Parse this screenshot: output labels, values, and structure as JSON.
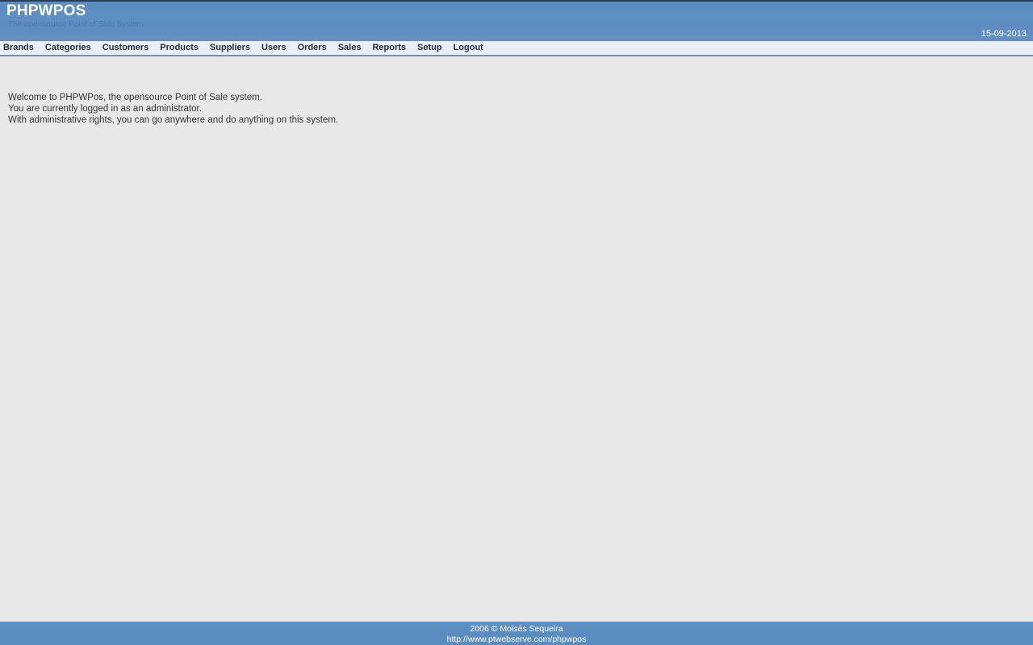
{
  "header": {
    "title": "PHPWPOS",
    "subtitle": "The opensource Point of Sale System",
    "date": "15-09-2013",
    "background_color": "#5b8cc0",
    "title_color": "#ffffff",
    "subtitle_color": "#4b7aad"
  },
  "nav": {
    "background_color": "#e9eff9",
    "text_color": "#1f2c3b",
    "border_color": "#6f8fb5",
    "items": [
      {
        "label": "Brands"
      },
      {
        "label": "Categories"
      },
      {
        "label": "Customers"
      },
      {
        "label": "Products"
      },
      {
        "label": "Suppliers"
      },
      {
        "label": "Users"
      },
      {
        "label": "Orders"
      },
      {
        "label": "Sales"
      },
      {
        "label": "Reports"
      },
      {
        "label": "Setup"
      },
      {
        "label": "Logout"
      }
    ]
  },
  "content": {
    "background_color": "#e8e8e8",
    "welcome_lines": [
      "Welcome to PHPWPos, the opensource Point of Sale system.",
      "You are currently logged in as an administrator.",
      "With administrative rights, you can go anywhere and do anything on this system."
    ]
  },
  "footer": {
    "background_color": "#5b8cc0",
    "copyright": "2006 © Moisés Sequeira",
    "url": "http://www.ptwebserve.com/phpwpos",
    "text_color": "#ffffff"
  }
}
